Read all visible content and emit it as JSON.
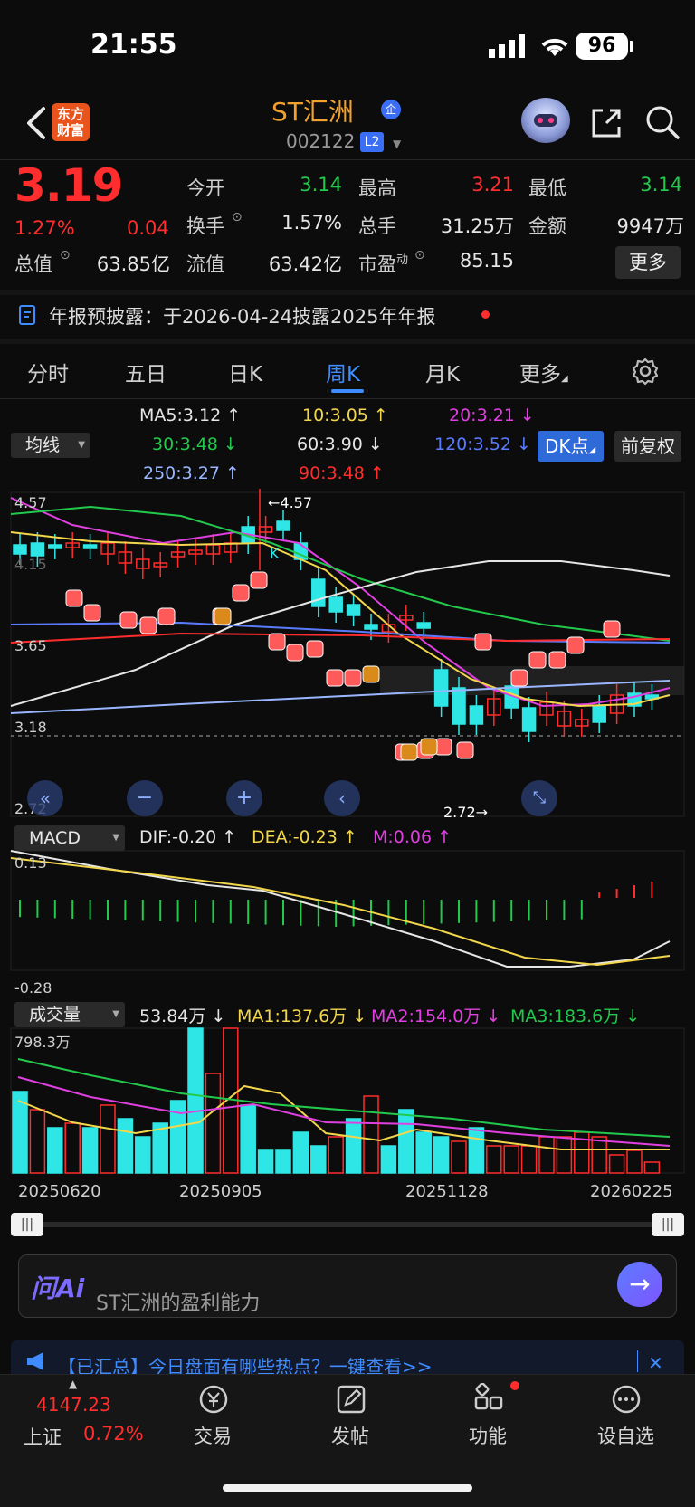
{
  "status_bar": {
    "time": "21:55",
    "battery": "96"
  },
  "header": {
    "logo_line1": "东方",
    "logo_line2": "财富",
    "stock_name": "ST汇洲",
    "enterprise_badge": "企",
    "stock_code": "002122",
    "level_badge": "L2"
  },
  "quote": {
    "price": "3.19",
    "change_pct": "1.27%",
    "change": "0.04",
    "fields": [
      {
        "label": "今开",
        "value": "3.14",
        "color": "green"
      },
      {
        "label": "最高",
        "value": "3.21",
        "color": "red"
      },
      {
        "label": "最低",
        "value": "3.14",
        "color": "green"
      },
      {
        "label": "换手",
        "value": "1.57%",
        "color": "white"
      },
      {
        "label": "总手",
        "value": "31.25万",
        "color": "white"
      },
      {
        "label": "金额",
        "value": "9947万",
        "color": "white"
      },
      {
        "label": "总值",
        "value": "63.85亿",
        "color": "white"
      },
      {
        "label": "流值",
        "value": "63.42亿",
        "color": "white"
      },
      {
        "label": "市盈",
        "label_sup": "动",
        "value": "85.15",
        "color": "white"
      }
    ],
    "more_label": "更多"
  },
  "notice": {
    "text": "年报预披露：于2026-04-24披露2025年年报"
  },
  "tabs": [
    "分时",
    "五日",
    "日K",
    "周K",
    "月K",
    "更多"
  ],
  "active_tab": "周K",
  "ma_header": {
    "dropdown": "均线",
    "ma5": "MA5:3.12",
    "ma10": "10:3.05",
    "ma20": "20:3.21",
    "ma30": "30:3.48",
    "ma60": "60:3.90",
    "ma120": "120:3.52",
    "ma250": "250:3.27",
    "ma90": "90:3.48",
    "dk_button": "DK点",
    "adjust_button": "前复权"
  },
  "kline": {
    "y_labels": {
      "top": "4.57",
      "mid_high": "4.15",
      "mid": "3.65",
      "current": "3.18",
      "bottom": "2.72"
    },
    "high_mark": "←4.57",
    "low_mark": "2.72→",
    "k_marker": "K"
  },
  "macd": {
    "dropdown": "MACD",
    "dif": "DIF:-0.20",
    "dea": "DEA:-0.23",
    "m": "M:0.06",
    "y_top": "0.13",
    "y_bottom": "-0.28"
  },
  "volume": {
    "dropdown": "成交量",
    "vol": "53.84万",
    "ma1": "MA1:137.6万",
    "ma2": "MA2:154.0万",
    "ma3": "MA3:183.6万",
    "y_top": "798.3万"
  },
  "dates": [
    "20250620",
    "20250905",
    "20251128",
    "20260225"
  ],
  "ai": {
    "logo": "问Ai",
    "placeholder": "ST汇洲的盈利能力"
  },
  "banner": {
    "text": "【已汇总】今日盘面有哪些热点？一键查看>>"
  },
  "bottom_nav": {
    "index_value": "4147.23",
    "index_name": "上证",
    "index_pct": "0.72%",
    "items": [
      "交易",
      "发帖",
      "功能",
      "设自选"
    ]
  },
  "colors": {
    "up": "#ff2d2d",
    "down": "#22c94c",
    "accent": "#3f8cff",
    "brand": "#f2a12d",
    "candle_down": "#2ee6e6"
  }
}
